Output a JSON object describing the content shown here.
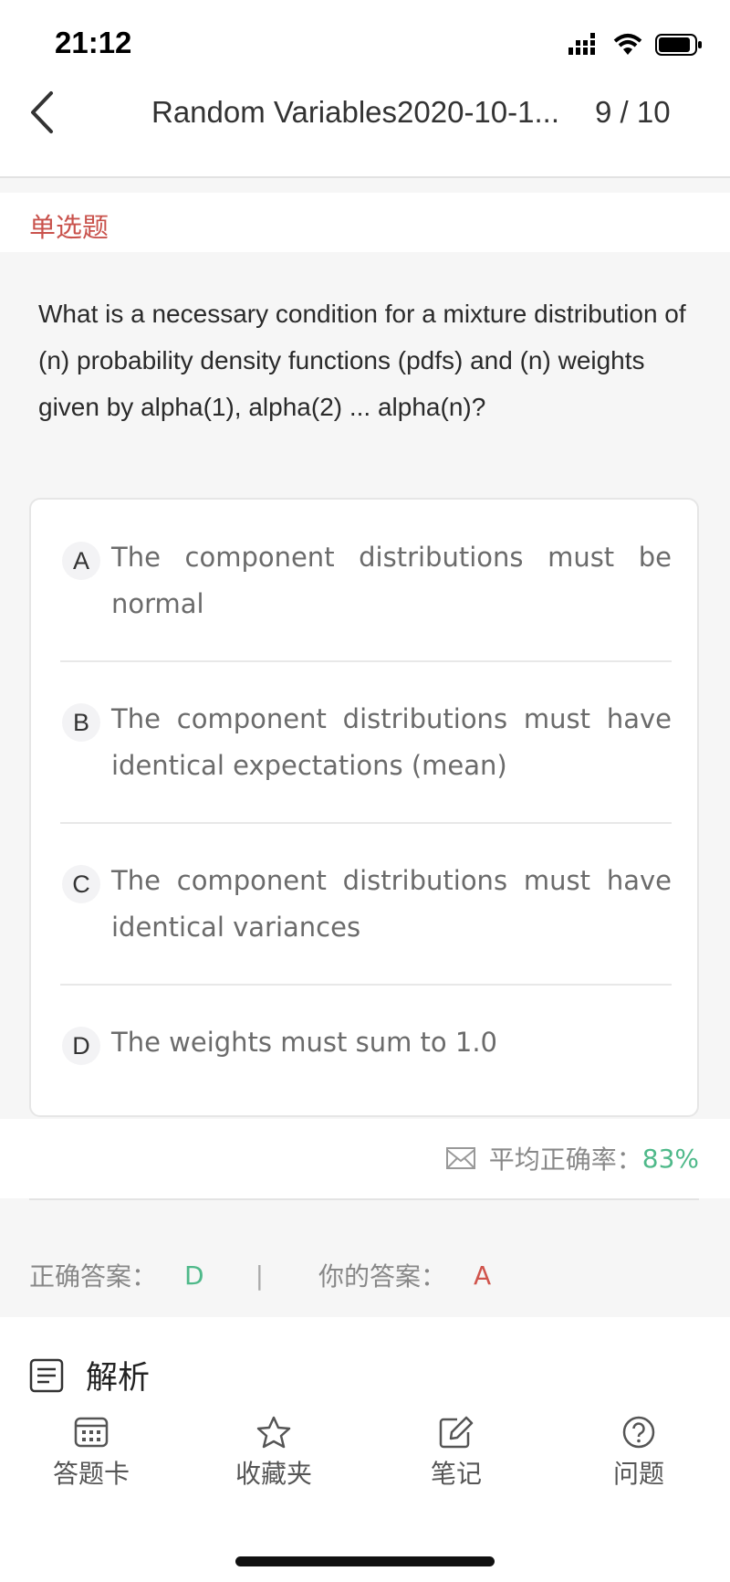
{
  "status_bar": {
    "time": "21:12"
  },
  "header": {
    "title": "Random Variables2020-10-1...",
    "counter": "9 / 10"
  },
  "question_type": "单选题",
  "question_text": "What is a necessary condition for a mixture distribution of (n) probability density functions (pdfs) and (n) weights given by alpha(1), alpha(2) ... alpha(n)?",
  "options": [
    {
      "letter": "A",
      "text": "The component distributions must be normal"
    },
    {
      "letter": "B",
      "text": "The component distributions must have identical expectations (mean)"
    },
    {
      "letter": "C",
      "text": "The component distributions must have identical variances"
    },
    {
      "letter": "D",
      "text": "The weights must sum to 1.0"
    }
  ],
  "accuracy": {
    "label": "平均正确率：",
    "value": "83%"
  },
  "answers": {
    "correct_label": "正确答案：",
    "correct_value": "D",
    "separator": "|",
    "yours_label": "你的答案：",
    "yours_value": "A"
  },
  "analysis": {
    "title": "解析"
  },
  "tabbar": [
    {
      "label": "答题卡",
      "icon": "answer-card-icon"
    },
    {
      "label": "收藏夹",
      "icon": "star-icon"
    },
    {
      "label": "笔记",
      "icon": "note-edit-icon"
    },
    {
      "label": "问题",
      "icon": "question-circle-icon"
    }
  ],
  "colors": {
    "accent_red": "#c9524c",
    "correct_green": "#4fb98a",
    "wrong_red": "#d0544c"
  }
}
